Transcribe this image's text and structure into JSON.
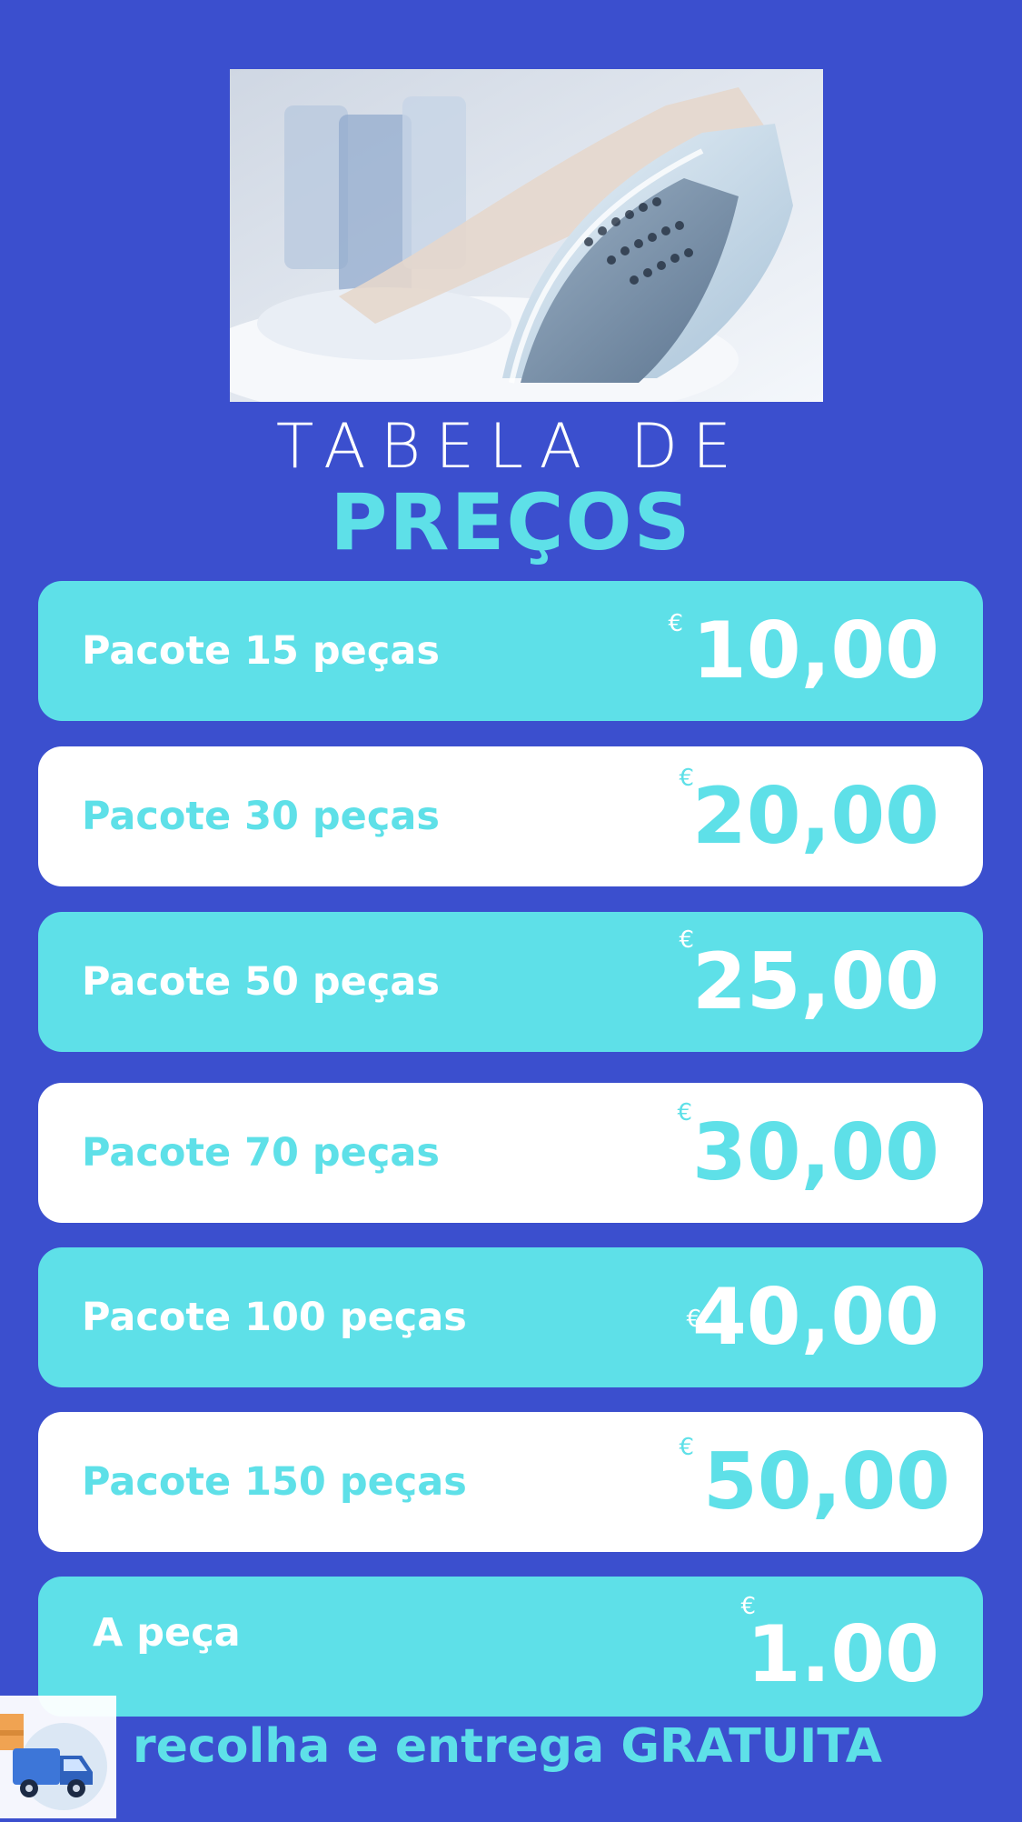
{
  "hero": {
    "image_subject": "iron-photo"
  },
  "title": {
    "line1": "TABELA DE",
    "line2": "PREÇOS"
  },
  "colors": {
    "background": "#3b4fce",
    "accent_cyan": "#5ee0e8",
    "white": "#ffffff"
  },
  "prices": [
    {
      "label": "Pacote 15 peças",
      "currency": "€",
      "amount": "10,00"
    },
    {
      "label": "Pacote 30 peças",
      "currency": "€",
      "amount": "20,00"
    },
    {
      "label": "Pacote 50 peças",
      "currency": "€",
      "amount": "25,00"
    },
    {
      "label": "Pacote 70 peças",
      "currency": "€",
      "amount": "30,00"
    },
    {
      "label": "Pacote 100 peças",
      "currency": "€",
      "amount": "40,00"
    },
    {
      "label": "Pacote 150 peças",
      "currency": "€",
      "amount": "50,00"
    },
    {
      "label": "A peça",
      "currency": "€",
      "amount": "1.00"
    }
  ],
  "footer": {
    "icon": "delivery-van-icon",
    "text": "recolha e entrega GRATUITA"
  }
}
